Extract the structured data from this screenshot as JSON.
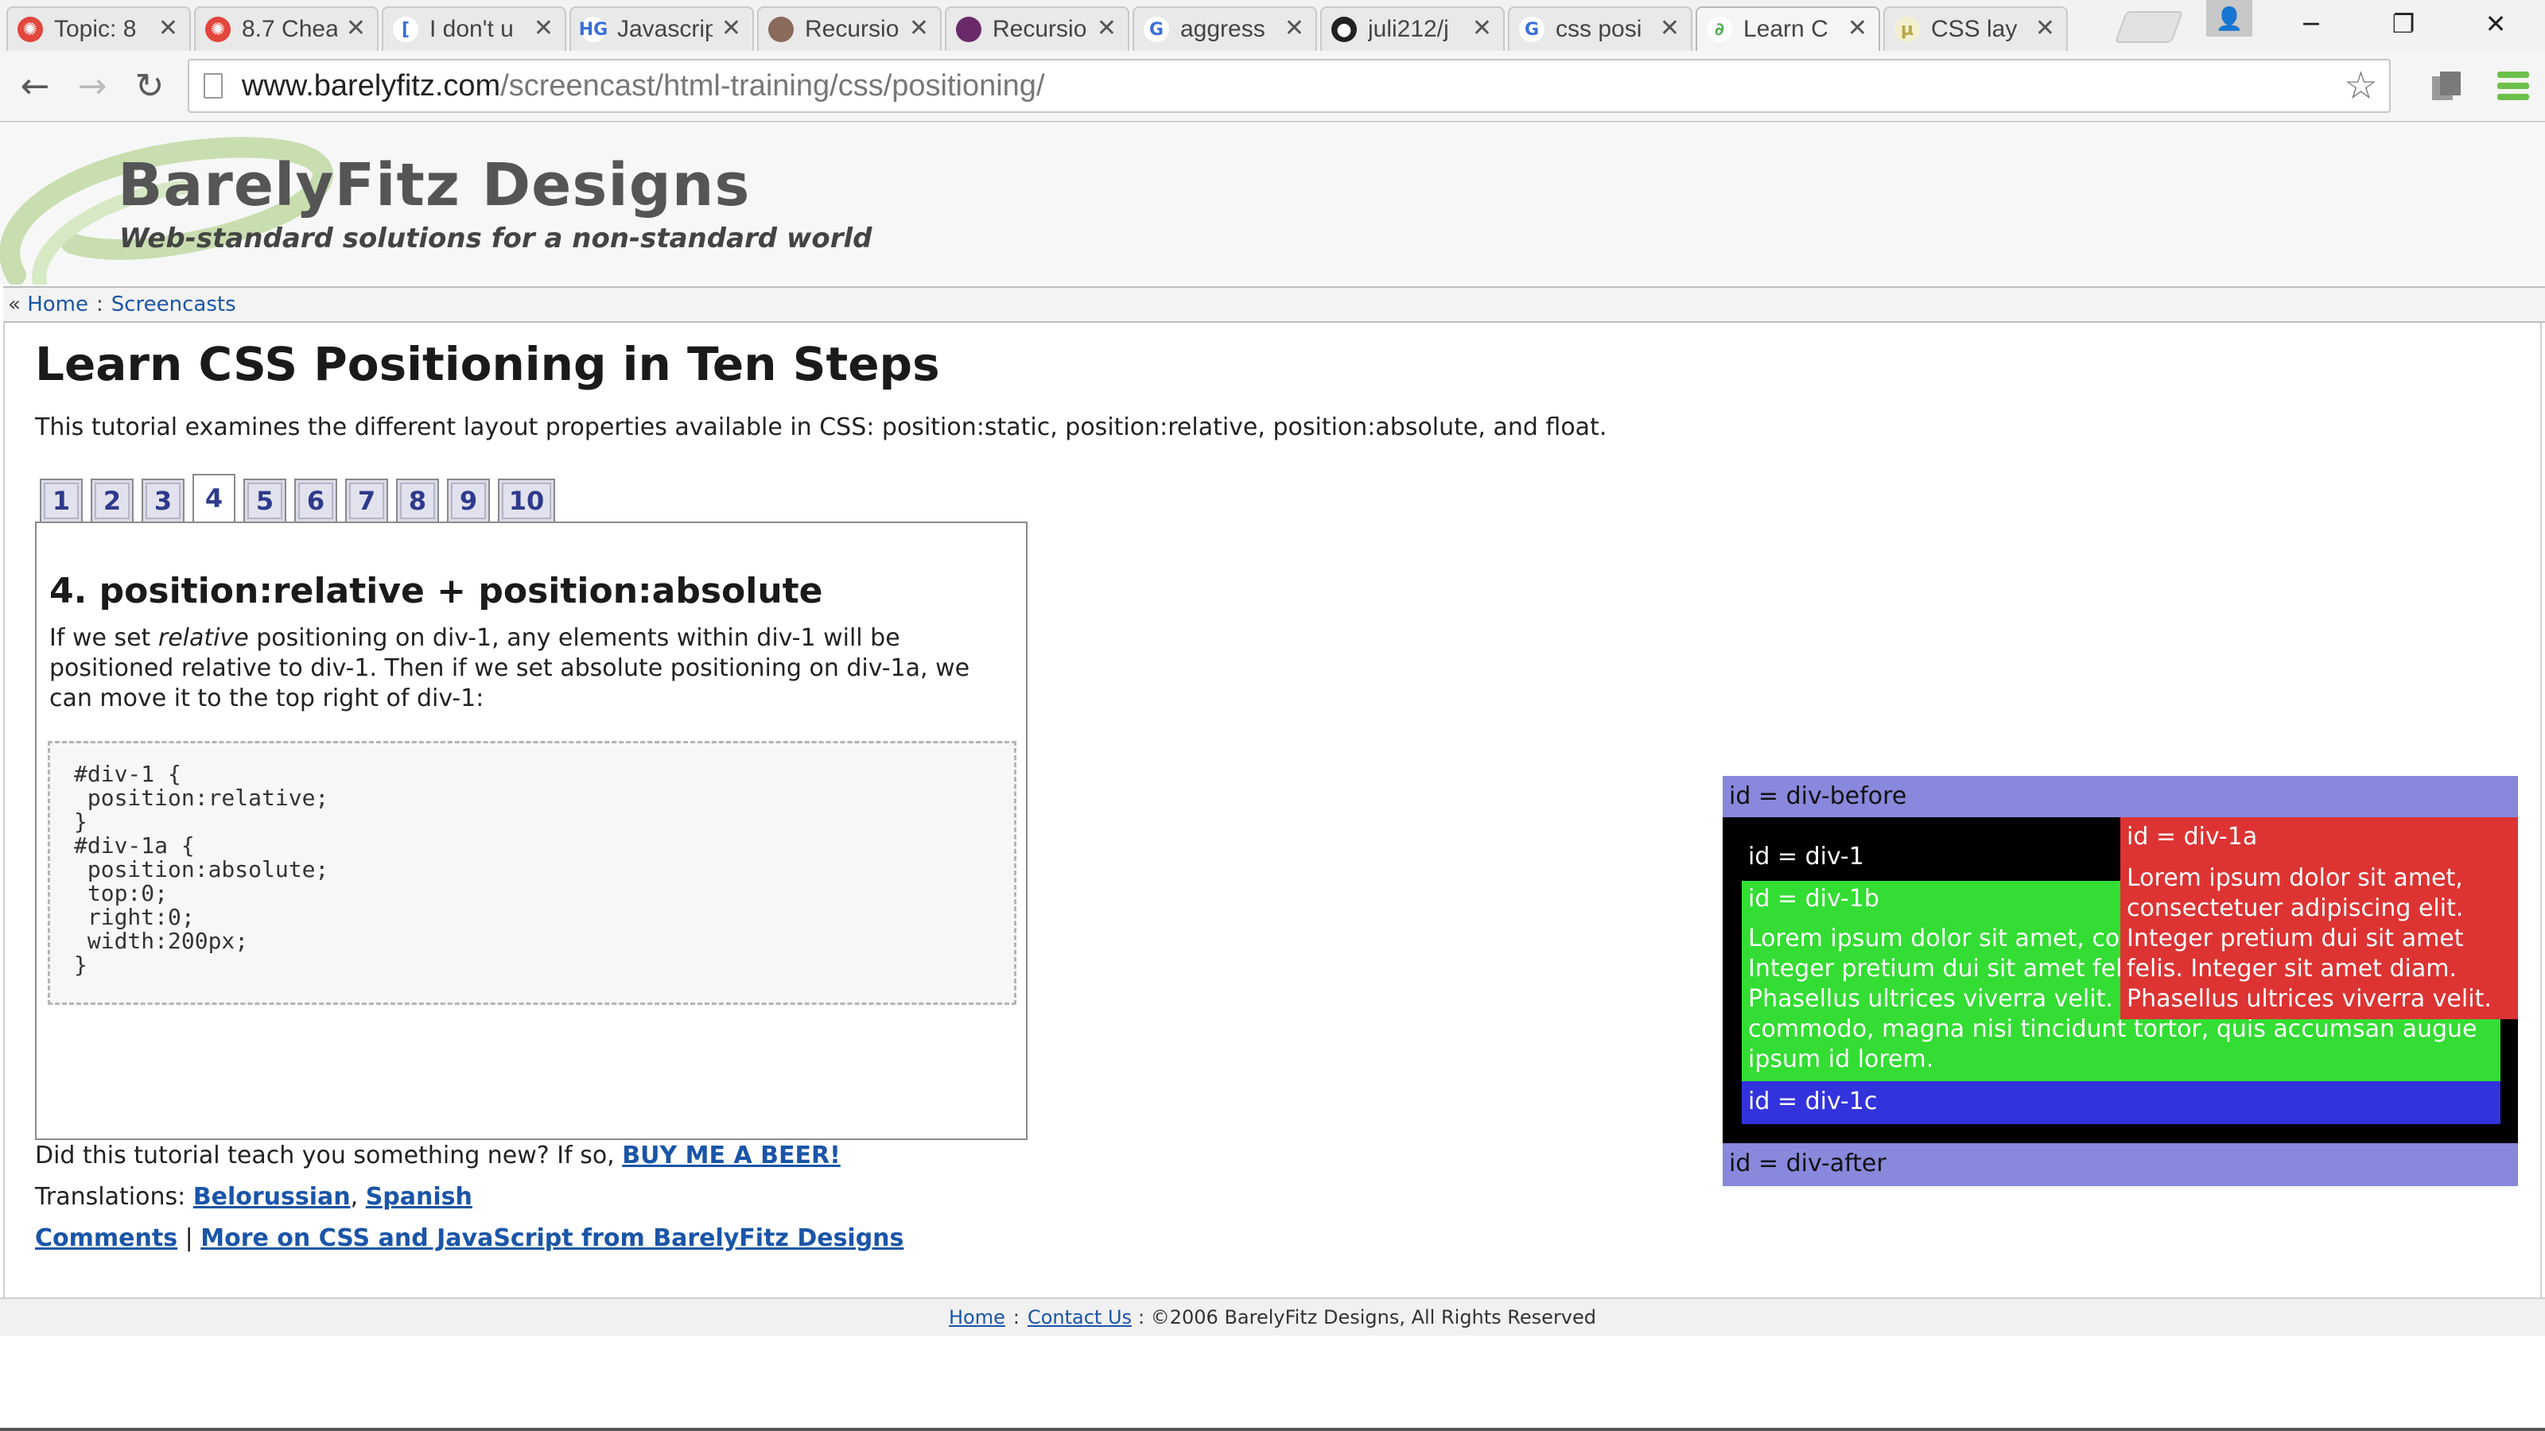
{
  "browser": {
    "tabs": [
      {
        "title": "Topic: 8",
        "icon": "gear-red-icon",
        "color": "#e2463c",
        "glyph": "✺"
      },
      {
        "title": "8.7 Chea",
        "icon": "gear-red-icon",
        "color": "#e2463c",
        "glyph": "✺"
      },
      {
        "title": "I don't u",
        "icon": "c-bracket-icon",
        "color": "#ffffff",
        "glyph": "["
      },
      {
        "title": "Javascrip",
        "icon": "hg-icon",
        "color": "#ffffff",
        "glyph": "HG"
      },
      {
        "title": "Recursio",
        "icon": "avatar-photo-icon",
        "color": "#8a6a5a",
        "glyph": ""
      },
      {
        "title": "Recursio",
        "icon": "purple-orb-icon",
        "color": "#6a2a6a",
        "glyph": ""
      },
      {
        "title": "aggress",
        "icon": "google-icon",
        "color": "#ffffff",
        "glyph": "G"
      },
      {
        "title": "juli212/j",
        "icon": "github-icon",
        "color": "#222222",
        "glyph": "●"
      },
      {
        "title": "css posi",
        "icon": "google-icon",
        "color": "#ffffff",
        "glyph": "G"
      },
      {
        "title": "Learn C",
        "icon": "swirl-green-icon",
        "color": "#ffffff",
        "glyph": "∂"
      },
      {
        "title": "CSS lay",
        "icon": "mu-icon",
        "color": "#f3f0d0",
        "glyph": "µ"
      }
    ],
    "close_glyph": "✕",
    "window": {
      "minimize": "─",
      "restore": "❐",
      "close": "✕"
    },
    "url_host": "www.barelyfitz.com",
    "url_path": "/screencast/html-training/css/positioning/",
    "back_glyph": "←",
    "forward_glyph": "→",
    "reload_glyph": "↻",
    "star_glyph": "☆"
  },
  "site": {
    "title": "BarelyFitz Designs",
    "tagline": "Web-standard solutions for a non-standard world"
  },
  "breadcrumb": {
    "prefix": "«",
    "home": "Home",
    "sep": ":",
    "screencasts": "Screencasts"
  },
  "main": {
    "title": "Learn CSS Positioning in Ten Steps",
    "intro": "This tutorial examines the different layout properties available in CSS: position:static, position:relative, position:absolute, and float.",
    "steps": [
      "1",
      "2",
      "3",
      "4",
      "5",
      "6",
      "7",
      "8",
      "9",
      "10"
    ],
    "active_step": "4",
    "step_heading": "4. position:relative + position:absolute",
    "step_text_1": "If we set ",
    "step_text_em": "relative",
    "step_text_2": " positioning on div-1, any elements within div-1 will be positioned relative to div-1. Then if we set absolute positioning on div-1a, we can move it to the top right of div-1:",
    "code": "#div-1 {\n position:relative;\n}\n#div-1a {\n position:absolute;\n top:0;\n right:0;\n width:200px;\n}"
  },
  "demo": {
    "div_before": "id = div-before",
    "div_1": "id = div-1",
    "div_1a_label": "id = div-1a",
    "div_1a_text": "Lorem ipsum dolor sit amet, consectetuer adipiscing elit. Integer pretium dui sit amet felis. Integer sit amet diam. Phasellus ultrices viverra velit.",
    "div_1b_label": "id = div-1b",
    "div_1b_text": "Lorem ipsum dolor sit amet, consectetuer adipiscing elit. Integer pretium dui sit amet felis. Integer sit amet diam. Phasellus ultrices viverra velit. Nam mattis, arcu ut bibendum commodo, magna nisi tincidunt tortor, quis accumsan augue ipsum id lorem.",
    "div_1c": "id = div-1c",
    "div_after": "id = div-after"
  },
  "footer_links": {
    "beer_prefix": "Did this tutorial teach you something new? If so, ",
    "beer_link": "BUY ME A BEER!",
    "translations_prefix": "Translations: ",
    "belorussian": "Belorussian",
    "comma": ", ",
    "spanish": "Spanish",
    "comments": "Comments",
    "pipe": " | ",
    "more": "More on CSS and JavaScript from BarelyFitz Designs"
  },
  "site_footer": {
    "home": "Home",
    "sep": ":",
    "contact": "Contact Us",
    "copyright": ": ©2006 BarelyFitz Designs, All Rights Reserved"
  },
  "colors": {
    "div_before": "#8888dd",
    "div_1": "#000000",
    "div_1a": "#dd3333",
    "div_1b": "#33dd33",
    "div_1c": "#3333dd",
    "link": "#1a55a8"
  }
}
